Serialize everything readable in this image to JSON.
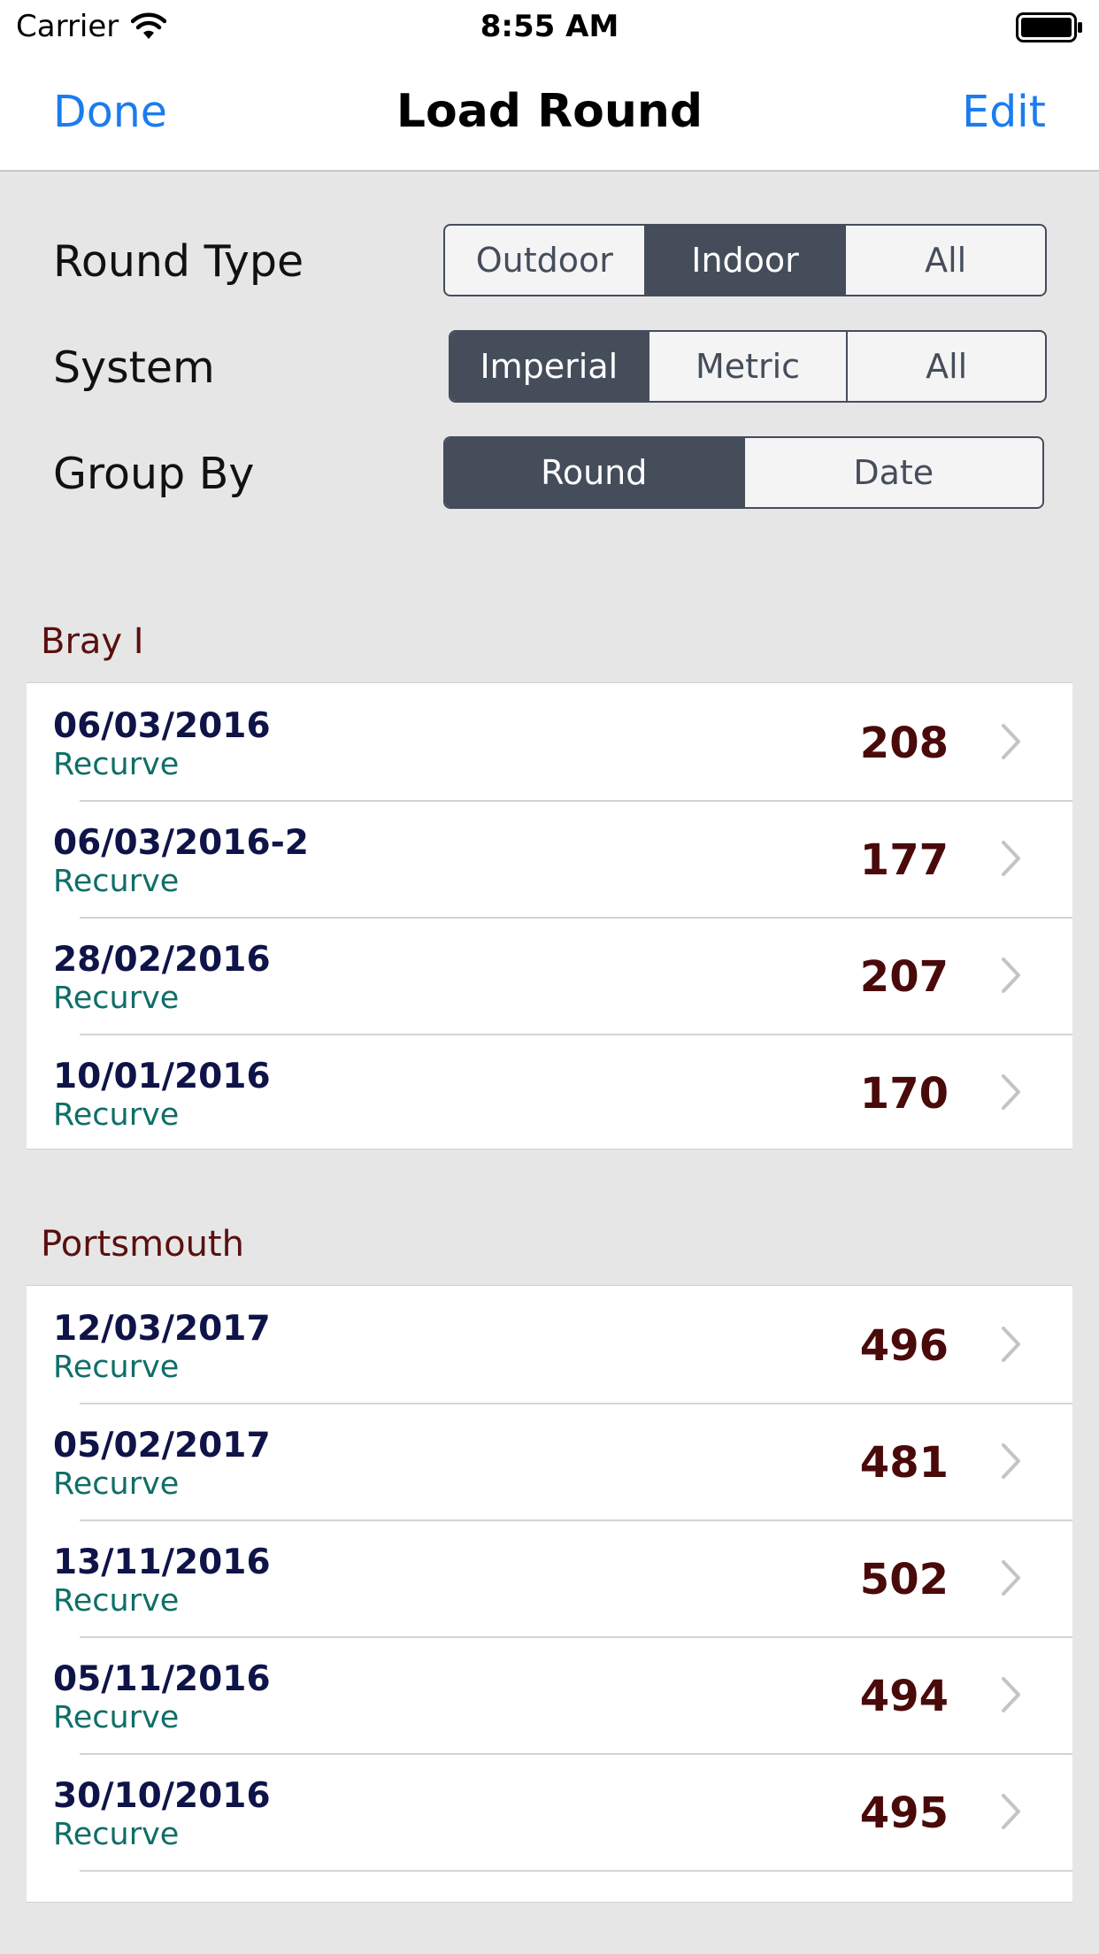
{
  "status_bar": {
    "carrier": "Carrier",
    "time": "8:55 AM"
  },
  "nav": {
    "left_button": "Done",
    "title": "Load Round",
    "right_button": "Edit"
  },
  "filters": {
    "round_type": {
      "label": "Round Type",
      "options": [
        "Outdoor",
        "Indoor",
        "All"
      ],
      "selected": "Indoor"
    },
    "system": {
      "label": "System",
      "options": [
        "Imperial",
        "Metric",
        "All"
      ],
      "selected": "Imperial"
    },
    "group_by": {
      "label": "Group By",
      "options": [
        "Round",
        "Date"
      ],
      "selected": "Round"
    }
  },
  "sections": [
    {
      "title": "Bray I",
      "rows": [
        {
          "date": "06/03/2016",
          "bow": "Recurve",
          "score": "208"
        },
        {
          "date": "06/03/2016-2",
          "bow": "Recurve",
          "score": "177"
        },
        {
          "date": "28/02/2016",
          "bow": "Recurve",
          "score": "207"
        },
        {
          "date": "10/01/2016",
          "bow": "Recurve",
          "score": "170"
        }
      ]
    },
    {
      "title": "Portsmouth",
      "rows": [
        {
          "date": "12/03/2017",
          "bow": "Recurve",
          "score": "496"
        },
        {
          "date": "05/02/2017",
          "bow": "Recurve",
          "score": "481"
        },
        {
          "date": "13/11/2016",
          "bow": "Recurve",
          "score": "502"
        },
        {
          "date": "05/11/2016",
          "bow": "Recurve",
          "score": "494"
        },
        {
          "date": "30/10/2016",
          "bow": "Recurve",
          "score": "495"
        }
      ]
    }
  ],
  "colors": {
    "accent": "#1a7cf0",
    "segment_selected": "#454d5b",
    "date_text": "#0f1448",
    "bow_text": "#0f6e68",
    "score_text": "#4a0a0a",
    "section_header": "#5a0f0f"
  }
}
